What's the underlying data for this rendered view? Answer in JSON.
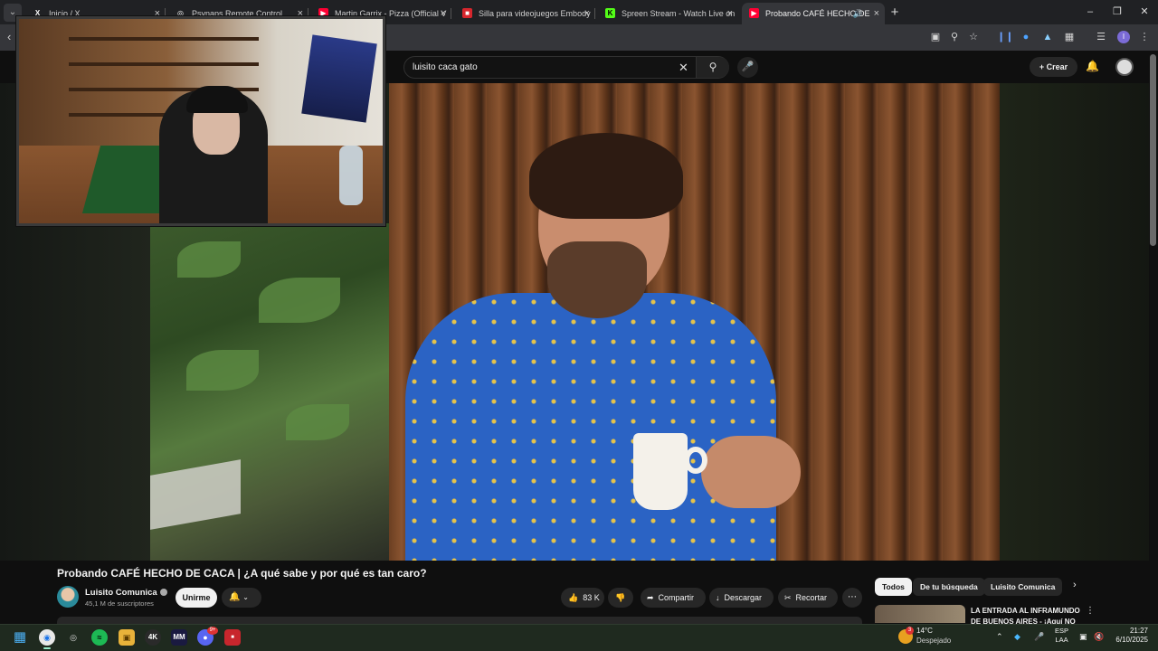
{
  "browser": {
    "tabs": [
      {
        "title": "Inicio / X",
        "favicon": "X",
        "favicon_color": "#000000"
      },
      {
        "title": "Psynaps Remote Control",
        "favicon": "◎",
        "favicon_color": "#3a3a3a"
      },
      {
        "title": "Martin Garrix - Pizza (Official V",
        "favicon": "▶",
        "favicon_color": "#ff0033"
      },
      {
        "title": "Silla para videojuegos Embody",
        "favicon": "■",
        "favicon_color": "#d7262d"
      },
      {
        "title": "Spreen Stream - Watch Live on",
        "favicon": "K",
        "favicon_color": "#53fc18"
      },
      {
        "title": "Probando CAFÉ HECHO DE",
        "favicon": "▶",
        "favicon_color": "#ff0033"
      }
    ],
    "profile_initial": "I"
  },
  "youtube": {
    "search_query": "luisito caca gato",
    "create_label": "Crear"
  },
  "video": {
    "title": "Probando CAFÉ HECHO DE CACA | ¿A qué sabe y por qué es tan caro?",
    "channel_name": "Luisito Comunica",
    "subscribers": "45,1 M de suscriptores",
    "join_label": "Unirme",
    "likes": "83 K",
    "share_label": "Compartir",
    "download_label": "Descargar",
    "clip_label": "Recortar"
  },
  "sidebar": {
    "chips": [
      "Todos",
      "De tu búsqueda",
      "Luisito Comunica"
    ],
    "recommendation_title": "LA ENTRADA AL INFRAMUNDO DE BUENOS AIRES - ¡Aquí NO"
  },
  "taskbar": {
    "weather_temp": "14°C",
    "weather_condition": "Despejado",
    "weather_badge": "3",
    "discord_badge": "9+",
    "lang_top": "ESP",
    "lang_bottom": "LAA",
    "time": "21:27",
    "date": "6/10/2025"
  },
  "colors": {
    "youtube_red": "#ff0033",
    "background": "#0f0f0f",
    "chip_bg": "#272727"
  }
}
